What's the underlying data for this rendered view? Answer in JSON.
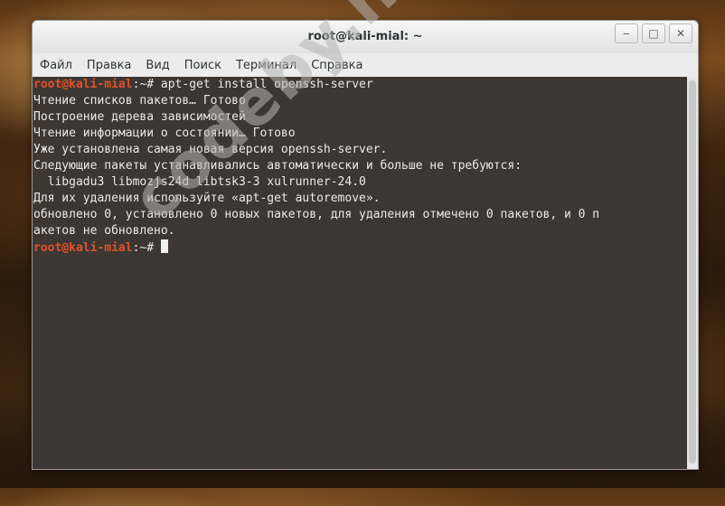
{
  "window": {
    "title": "root@kali-mial: ~"
  },
  "window_buttons": {
    "minimize": "‒",
    "maximize": "□",
    "close": "✕"
  },
  "menu": [
    "Файл",
    "Правка",
    "Вид",
    "Поиск",
    "Терминал",
    "Справка"
  ],
  "terminal": {
    "prompt_user": "root@kali-mial",
    "prompt_path": ":~# ",
    "command": "apt-get install openssh-server",
    "output": [
      "Чтение списков пакетов… Готово",
      "Построение дерева зависимостей",
      "Чтение информации о состоянии… Готово",
      "Уже установлена самая новая версия openssh-server.",
      "Следующие пакеты устанавливались автоматически и больше не требуются:",
      "  libgadu3 libmozjs24d libtsk3-3 xulrunner-24.0",
      "Для их удаления используйте «apt-get autoremove».",
      "обновлено 0, установлено 0 новых пакетов, для удаления отмечено 0 пакетов, и 0 п",
      "акетов не обновлено."
    ]
  },
  "watermark": "codeby.net"
}
